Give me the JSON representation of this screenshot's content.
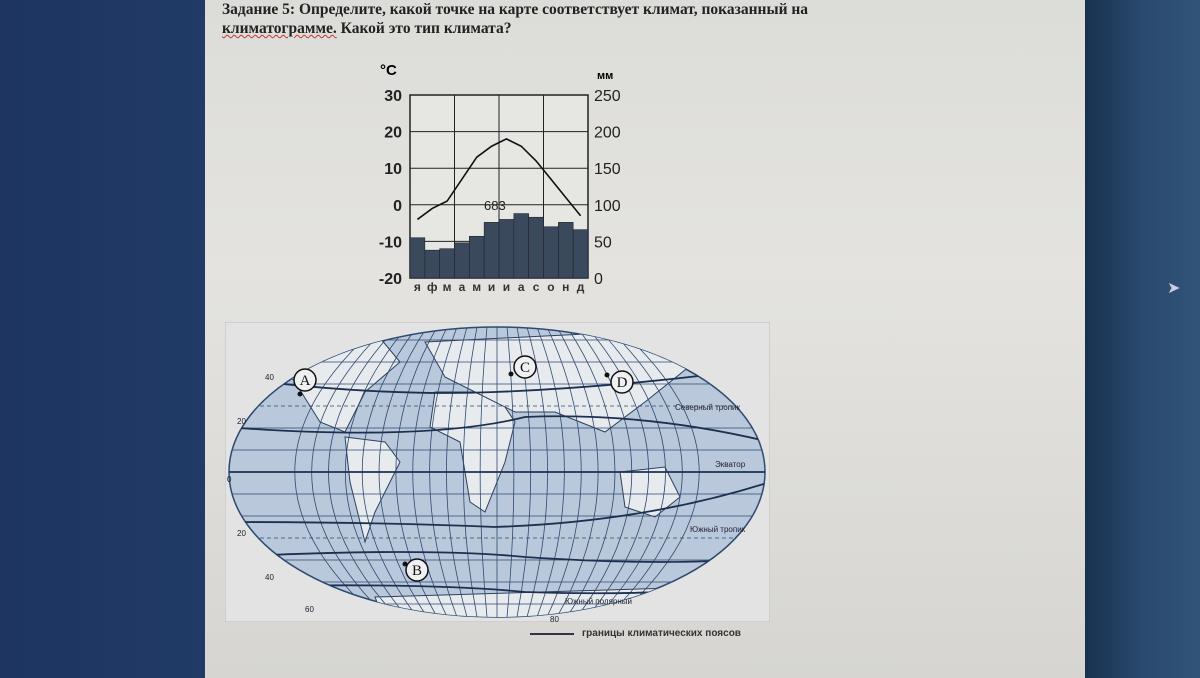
{
  "task": {
    "label": "Задание 5:",
    "text": "Определите, какой точке на карте соответствует климат, показанный на",
    "text2": "климатограмме.",
    "question": "Какой это тип климата?"
  },
  "chart_data": {
    "type": "bar+line",
    "title": "",
    "left_axis_label": "°С",
    "right_axis_label": "мм",
    "categories": [
      "я",
      "ф",
      "м",
      "а",
      "м",
      "и",
      "и",
      "а",
      "с",
      "о",
      "н",
      "д"
    ],
    "temperature_c": [
      -4,
      -1,
      1,
      7,
      13,
      16,
      18,
      16,
      12,
      7,
      2,
      -3
    ],
    "precipitation_mm": [
      55,
      38,
      40,
      48,
      57,
      76,
      80,
      88,
      83,
      70,
      76,
      66
    ],
    "annual_precipitation_label": "683",
    "left_ticks": [
      "30",
      "20",
      "10",
      "0",
      "-10",
      "-20"
    ],
    "right_ticks": [
      "250",
      "200",
      "150",
      "100",
      "50",
      "0"
    ],
    "ylim_temp": [
      -20,
      30
    ],
    "ylim_precip": [
      0,
      250
    ],
    "colors": {
      "bars": "#3a4a5c",
      "line": "#111"
    }
  },
  "map": {
    "points": [
      "A",
      "B",
      "C",
      "D"
    ],
    "labels": {
      "north_tropic": "Северный тропик",
      "equator": "Экватор",
      "south_tropic": "Южный тропик",
      "south_polar": "Южный полярный",
      "lat20": "20",
      "lat40": "40",
      "lat60": "60",
      "lat80": "80",
      "lat0": "0"
    },
    "legend": "границы климатических поясов"
  }
}
